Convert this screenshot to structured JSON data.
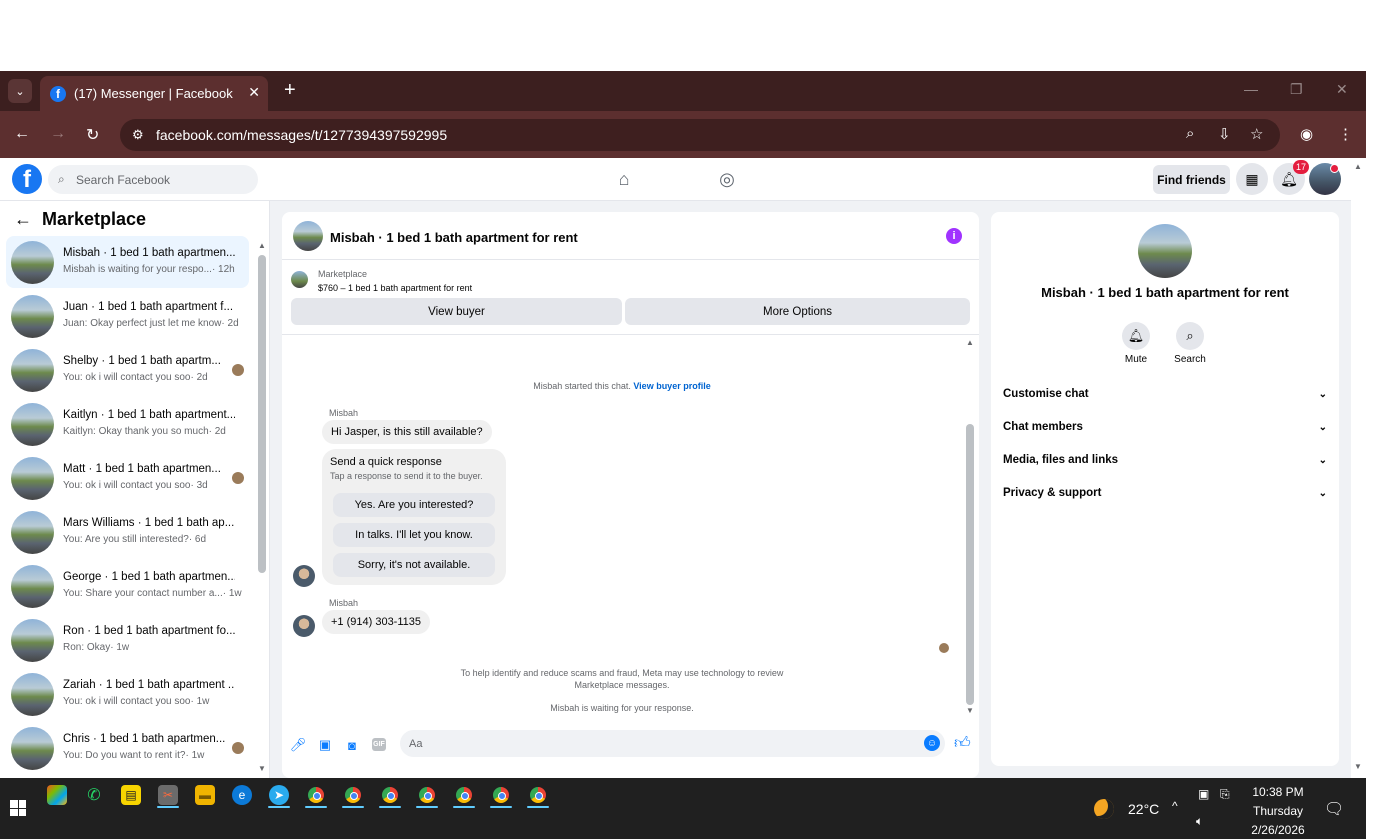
{
  "browser": {
    "tab_title": "(17) Messenger | Facebook",
    "url": "facebook.com/messages/t/1277394397592995"
  },
  "fb_header": {
    "search_placeholder": "Search Facebook",
    "find_friends": "Find friends",
    "notification_count": "17"
  },
  "sidebar": {
    "title": "Marketplace",
    "conversations": [
      {
        "name": "Misbah · 1 bed 1 bath apartmen...",
        "message": "Misbah is waiting for your respo...",
        "time": "· 12h",
        "active": true,
        "seen": false
      },
      {
        "name": "Juan · 1 bed 1 bath apartment f...",
        "message": "Juan: Okay perfect just let me know",
        "time": "· 2d",
        "active": false,
        "seen": false
      },
      {
        "name": "Shelby · 1 bed 1 bath apartm...",
        "message": "You: ok i will contact you soo",
        "time": "· 2d",
        "active": false,
        "seen": true
      },
      {
        "name": "Kaitlyn · 1 bed 1 bath apartment...",
        "message": "Kaitlyn: Okay thank you so much",
        "time": "· 2d",
        "active": false,
        "seen": false
      },
      {
        "name": "Matt · 1 bed 1 bath apartmen...",
        "message": "You: ok i will contact you soo",
        "time": "· 3d",
        "active": false,
        "seen": true
      },
      {
        "name": "Mars Williams · 1 bed 1 bath ap...",
        "message": "You: Are you still interested?",
        "time": "· 6d",
        "active": false,
        "seen": false
      },
      {
        "name": "George · 1 bed 1 bath apartmen...",
        "message": "You: Share your contact number a...",
        "time": "· 1w",
        "active": false,
        "seen": false
      },
      {
        "name": "Ron · 1 bed 1 bath apartment fo...",
        "message": "Ron: Okay",
        "time": "· 1w",
        "active": false,
        "seen": false
      },
      {
        "name": "Zariah · 1 bed 1 bath apartment ...",
        "message": "You: ok i will contact you soo",
        "time": "· 1w",
        "active": false,
        "seen": false
      },
      {
        "name": "Chris · 1 bed 1 bath apartmen...",
        "message": "You: Do you want to rent it?",
        "time": "· 1w",
        "active": false,
        "seen": true
      }
    ]
  },
  "chat": {
    "title": "Misbah · 1 bed 1 bath apartment for rent",
    "marketplace_label": "Marketplace",
    "listing": "$760 – 1 bed 1 bath apartment for rent",
    "view_buyer": "View buyer",
    "more_options": "More Options",
    "started_note": "Misbah started this chat.",
    "view_buyer_profile": "View buyer profile",
    "sender1": "Misbah",
    "msg1": "Hi Jasper, is this still available?",
    "quick_title": "Send a quick response",
    "quick_sub": "Tap a response to send it to the buyer.",
    "quick_responses": [
      "Yes. Are you interested?",
      "In talks. I'll let you know.",
      "Sorry, it's not available."
    ],
    "sender2": "Misbah",
    "msg2": "+1 (914) 303-1135",
    "scam_note_1": "To help identify and reduce scams and fraud, Meta may use technology to review",
    "scam_note_2": "Marketplace messages.",
    "waiting_note": "Misbah is waiting for your response.",
    "input_placeholder": "Aa"
  },
  "info_panel": {
    "name": "Misbah · 1 bed 1 bath apartment for rent",
    "mute": "Mute",
    "search": "Search",
    "sections": [
      "Customise chat",
      "Chat members",
      "Media, files and links",
      "Privacy & support"
    ]
  },
  "taskbar": {
    "temperature": "22°C",
    "time": "10:38 PM",
    "day": "Thursday",
    "date": "2/26/2026"
  },
  "colors": {
    "brand": "#1877f2",
    "tab_bar": "#3c1f1f",
    "address_bar": "#5c2f2f",
    "messenger_accent": "#0a7cff",
    "info_icon": "#a033ff"
  }
}
